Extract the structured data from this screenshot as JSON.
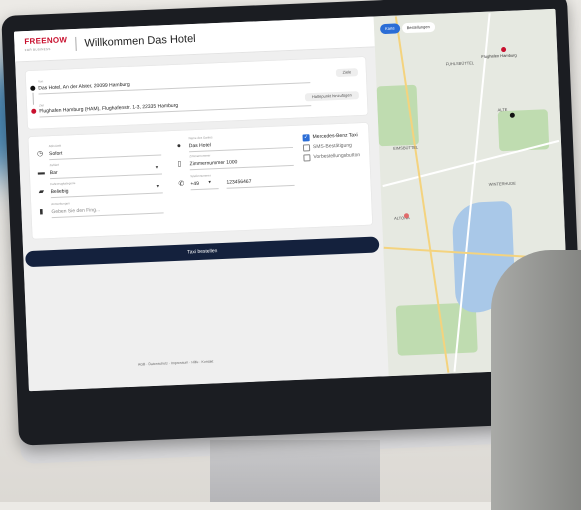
{
  "header": {
    "brand": "FREENOW",
    "brand_sub": "FOR BUSINESS",
    "title": "Willkommen Das Hotel"
  },
  "route": {
    "from_label": "Von",
    "from_value": "Das Hotel, An der Alster, 20099 Hamburg",
    "from_action": "Ziele",
    "to_label": "Ziel",
    "to_value": "Flughafen Hamburg (HAM), Flughafenstr. 1-3, 22335 Hamburg",
    "to_action": "Haltepunkt hinzufügen"
  },
  "form": {
    "time_label": "Abholzeit",
    "time_value": "Sofort",
    "payment_label": "Zahlart",
    "payment_value": "Bar",
    "vehicle_label": "Fahrzeugkategorie",
    "vehicle_value": "Beliebig",
    "notes_label": "Anmerkungen",
    "notes_placeholder": "Geben Sie den Fing...",
    "guest_label": "Name des Gastes",
    "guest_value": "Das Hotel",
    "room_label": "Zimmernummer",
    "room_value": "Zimmernummer 1000",
    "phone_label": "Telefonnummer",
    "phone_prefix": "+49",
    "phone_value": "123456467",
    "options": [
      {
        "label": "Mercedes-Benz Taxi",
        "checked": true
      },
      {
        "label": "SMS-Bestätigung",
        "checked": false
      },
      {
        "label": "Vorbestellungsbutton",
        "checked": false
      }
    ]
  },
  "submit_label": "Taxi bestellen",
  "footer_text": "AGB · Datenschutz · Impressum · Hilfe · Kontakt",
  "map": {
    "tabs": [
      "Karte",
      "Bestellungen"
    ],
    "labels": [
      "FUHLSBÜTTEL",
      "ALTONA",
      "WINTERHUDE",
      "EIMSBÜTTEL",
      "Flughafen Hamburg",
      "ALTE"
    ],
    "colors": {
      "water": "#a9c8e8",
      "park": "#bfdcb0",
      "pin": "#c8102e"
    }
  }
}
